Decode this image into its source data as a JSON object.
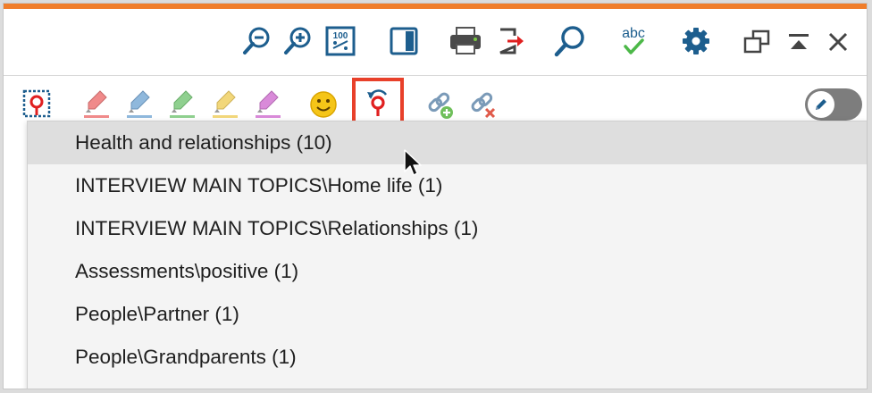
{
  "colors": {
    "accent_orange": "#f07d2a",
    "icon_blue": "#1d5e8e",
    "highlight_red": "#e8402a",
    "menu_hover": "#dedede"
  },
  "toolbar_top": {
    "icons": [
      "zoom-out-icon",
      "zoom-in-icon",
      "zoom-100-icon",
      "panel-layout-icon",
      "print-icon",
      "export-icon",
      "search-icon",
      "spellcheck-icon",
      "gear-icon",
      "undock-icon",
      "collapse-icon",
      "close-icon"
    ],
    "zoom_100_label": "100",
    "spellcheck_label": "abc"
  },
  "toolbar_bottom": {
    "icons": [
      "code-target-icon",
      "highlighter-red-icon",
      "highlighter-blue-icon",
      "highlighter-green-icon",
      "highlighter-yellow-icon",
      "highlighter-magenta-icon",
      "emoticon-icon",
      "recent-codes-icon",
      "link-add-icon",
      "link-remove-icon",
      "edit-toggle-icon"
    ],
    "highlighter_colors": [
      "#f08a8a",
      "#8fb8dc",
      "#8fd08f",
      "#f2d77a",
      "#d98ad9"
    ],
    "edit_toggle_state": "off"
  },
  "dropdown": {
    "items": [
      {
        "label": "Health and relationships (10)"
      },
      {
        "label": "INTERVIEW MAIN TOPICS\\Home life (1)"
      },
      {
        "label": "INTERVIEW MAIN TOPICS\\Relationships (1)"
      },
      {
        "label": "Assessments\\positive (1)"
      },
      {
        "label": "People\\Partner (1)"
      },
      {
        "label": "People\\Grandparents (1)"
      }
    ]
  }
}
